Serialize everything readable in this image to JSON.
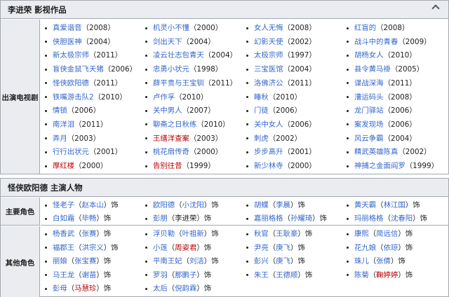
{
  "panel1": {
    "title": "李进荣 影视作品",
    "row_label": "出演电视剧",
    "columns": [
      [
        {
          "name": "真爱谐音",
          "year": "（2008）",
          "color": "blue"
        },
        {
          "name": "侠胆医神",
          "year": "（2004）",
          "color": "blue"
        },
        {
          "name": "新太极宗师",
          "year": "（2011）",
          "color": "blue"
        },
        {
          "name": "盲侠金鼠飞天猪",
          "year": "（2006）",
          "color": "blue"
        },
        {
          "name": "怪侠欧阳德",
          "year": "（2011）",
          "color": "blue"
        },
        {
          "name": "铁嘴游击队2",
          "year": "（2010）",
          "color": "blue"
        },
        {
          "name": "情锁",
          "year": "（2006）",
          "color": "blue"
        },
        {
          "name": "南洋泪",
          "year": "（2011）",
          "color": "blue"
        },
        {
          "name": "弄月",
          "year": "（2003）",
          "color": "blue"
        },
        {
          "name": "行行出状元",
          "year": "（2001）",
          "color": "blue"
        },
        {
          "name": "厚红楼",
          "year": "（2000）",
          "color": "red"
        }
      ],
      [
        {
          "name": "机灵小不懂",
          "year": "（2000）",
          "color": "blue"
        },
        {
          "name": "剑出天下",
          "year": "（2004）",
          "color": "blue"
        },
        {
          "name": "凌云壮志包青天",
          "year": "（2004）",
          "color": "blue"
        },
        {
          "name": "忠勇小状元",
          "year": "（1998）",
          "color": "blue"
        },
        {
          "name": "薛平贵与王宝钏",
          "year": "（2011）",
          "color": "blue"
        },
        {
          "name": "卢作孚",
          "year": "（2010）",
          "color": "blue"
        },
        {
          "name": "关中男人",
          "year": "（2007）",
          "color": "blue"
        },
        {
          "name": "聊斋之日秋练",
          "year": "（2010）",
          "color": "blue"
        },
        {
          "name": "王缮洋查案",
          "year": "（2003）",
          "color": "red"
        },
        {
          "name": "桃花扇传奇",
          "year": "（2000）",
          "color": "blue"
        },
        {
          "name": "告别往昔",
          "year": "（1999）",
          "color": "red"
        }
      ],
      [
        {
          "name": "女人无悔",
          "year": "（2008）",
          "color": "blue"
        },
        {
          "name": "幻影天使",
          "year": "（2002）",
          "color": "blue"
        },
        {
          "name": "太极宗师",
          "year": "（1997）",
          "color": "blue"
        },
        {
          "name": "三宝医馆",
          "year": "（2004）",
          "color": "blue"
        },
        {
          "name": "洛佛济公",
          "year": "（2011）",
          "color": "blue"
        },
        {
          "name": "睡秋",
          "year": "（2010）",
          "color": "blue"
        },
        {
          "name": "门徒",
          "year": "（2006）",
          "color": "blue"
        },
        {
          "name": "关中女人",
          "year": "（2006）",
          "color": "blue"
        },
        {
          "name": "刺虎",
          "year": "（2002）",
          "color": "blue"
        },
        {
          "name": "步步高升",
          "year": "（2001）",
          "color": "blue"
        },
        {
          "name": "新少林寺",
          "year": "（2000）",
          "color": "blue"
        }
      ],
      [
        {
          "name": "红盲的",
          "year": "（2008）",
          "color": "blue"
        },
        {
          "name": "战斗中的青春",
          "year": "（2009）",
          "color": "blue"
        },
        {
          "name": "胡杨女人",
          "year": "（2010）",
          "color": "blue"
        },
        {
          "name": "县令黄马褂",
          "year": "（2005）",
          "color": "blue"
        },
        {
          "name": "谍战深海",
          "year": "（2011）",
          "color": "blue"
        },
        {
          "name": "漕运码头",
          "year": "（2008）",
          "color": "blue"
        },
        {
          "name": "龙门驿站",
          "year": "（2006）",
          "color": "blue"
        },
        {
          "name": "案发现场",
          "year": "（2006）",
          "color": "blue"
        },
        {
          "name": "风云争霸",
          "year": "（2004）",
          "color": "blue"
        },
        {
          "name": "精武英雄陈真",
          "year": "（2002）",
          "color": "blue"
        },
        {
          "name": "神捕之金面阎罗",
          "year": "（1999）",
          "color": "blue"
        }
      ]
    ]
  },
  "panel2": {
    "title": "怪侠欧阳德 主演人物",
    "main_label": "主要角色",
    "other_label": "其他角色",
    "suffix": "饰",
    "main_rows": [
      [
        {
          "role": "怪老子",
          "actor": "赵本山",
          "actor_color": "blue"
        },
        {
          "role": "欧阳德",
          "actor": "小沈阳",
          "actor_color": "blue"
        },
        {
          "role": "胡蝶",
          "actor": "李晨",
          "actor_color": "blue"
        },
        {
          "role": "黄天霸",
          "actor": "林江国",
          "actor_color": "blue"
        }
      ],
      [
        {
          "role": "白如霜",
          "actor": "毕畅",
          "actor_color": "blue"
        },
        {
          "role": "彭朋",
          "actor": "李进荣",
          "actor_color": "dark"
        },
        {
          "role": "嘉丽格格",
          "actor": "孙耀琦",
          "actor_color": "blue"
        },
        {
          "role": "玛丽格格",
          "actor": "沈春阳",
          "actor_color": "blue"
        }
      ]
    ],
    "other_rows": [
      [
        {
          "role": "杨香武",
          "actor": "张赛",
          "actor_color": "blue"
        },
        {
          "role": "浮贝勒",
          "actor": "叶祖新",
          "actor_color": "blue"
        },
        {
          "role": "秋官",
          "actor": "王耿豪",
          "actor_color": "blue"
        },
        {
          "role": "康熙",
          "actor": "简远信",
          "actor_color": "blue"
        }
      ],
      [
        {
          "role": "福郡王",
          "actor": "洪宗义",
          "actor_color": "blue"
        },
        {
          "role": "小莲",
          "actor": "周姿君",
          "actor_color": "red"
        },
        {
          "role": "尹亮",
          "actor": "庚飞",
          "actor_color": "blue"
        },
        {
          "role": "花九娘",
          "actor": "依琼",
          "actor_color": "blue"
        }
      ],
      [
        {
          "role": "丽娘",
          "actor": "张宝赛",
          "actor_color": "blue"
        },
        {
          "role": "平南王妃",
          "actor": "刘洁",
          "actor_color": "blue"
        },
        {
          "role": "彭兴",
          "actor": "庚飞",
          "actor_color": "blue"
        },
        {
          "role": "珠儿",
          "actor": "张倩",
          "actor_color": "blue"
        }
      ],
      [
        {
          "role": "马王龙",
          "actor": "谢苗",
          "actor_color": "blue"
        },
        {
          "role": "罗羽",
          "actor": "那鹏子",
          "actor_color": "blue"
        },
        {
          "role": "朱王",
          "actor": "王德顺",
          "actor_color": "blue"
        },
        {
          "role": "陈菊",
          "actor": "鞠婷婷",
          "actor_color": "red"
        }
      ],
      [
        {
          "role": "彭母",
          "actor": "马慧珍",
          "actor_color": "red"
        },
        {
          "role": "太后",
          "actor": "倪韵霖",
          "actor_color": "blue"
        }
      ]
    ]
  }
}
